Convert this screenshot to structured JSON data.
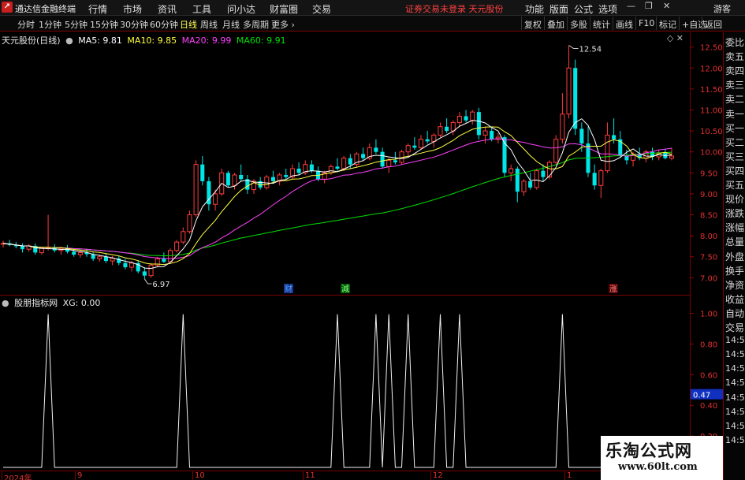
{
  "menubar": {
    "logo_glyph": "↗",
    "app_title": "通达信金融终端",
    "items": [
      "行情",
      "市场",
      "资讯",
      "工具",
      "问小达",
      "财富圈",
      "交易"
    ],
    "notice": "证券交易未登录  天元股份",
    "right_items": [
      "功能",
      "版面",
      "公式",
      "选项"
    ],
    "guest": "游客"
  },
  "tabbar": {
    "periods": [
      "分时",
      "1分钟",
      "5分钟",
      "15分钟",
      "30分钟",
      "60分钟",
      "日线",
      "周线",
      "月线",
      "多周期",
      "更多"
    ],
    "active_period": "日线",
    "tools": [
      "复权",
      "叠加",
      "多股",
      "统计",
      "画线",
      "F10",
      "标记",
      "+自选",
      "返回"
    ]
  },
  "main_legend": {
    "title": "天元股份(日线)",
    "ma5": "MA5: 9.81",
    "ma10": "MA10: 9.85",
    "ma20": "MA20: 9.99",
    "ma60": "MA60: 9.91",
    "colors": {
      "ma5": "#ffffff",
      "ma10": "#ffff40",
      "ma20": "#ff40ff",
      "ma60": "#00e000"
    }
  },
  "indicator_legend": {
    "title": "股朋指标网",
    "xg": "XG: 0.00"
  },
  "right_panel": [
    "委比",
    "卖五",
    "卖四",
    "卖三",
    "卖二",
    "卖一",
    "买一",
    "买二",
    "买三",
    "买四",
    "买五",
    "现价",
    "涨跌",
    "涨幅",
    "总量",
    "外盘",
    "换手",
    "净资",
    "收益",
    "自动",
    "交易",
    "14:56",
    "14:56",
    "14:56",
    "14:56",
    "14:56",
    "14:56",
    "14:56",
    "14:56"
  ],
  "date_axis": [
    "2024年",
    "9",
    "10",
    "11",
    "12",
    "1"
  ],
  "event_markers": [
    "财",
    "減",
    "涨"
  ],
  "watermark": {
    "line1": "乐淘公式网",
    "line2": "www.60lt.com"
  },
  "chart_data": [
    {
      "type": "candlestick",
      "title": "天元股份(日线)",
      "ylim": [
        6.8,
        12.7
      ],
      "yticks": [
        7.0,
        7.5,
        8.0,
        8.5,
        9.0,
        9.5,
        10.0,
        10.5,
        11.0,
        11.5,
        12.0,
        12.5
      ],
      "annotations": {
        "high": "12.54",
        "low": "6.97"
      },
      "ohlc": [
        [
          7.8,
          7.88,
          7.72,
          7.82
        ],
        [
          7.82,
          7.9,
          7.75,
          7.78
        ],
        [
          7.78,
          7.85,
          7.7,
          7.75
        ],
        [
          7.75,
          7.82,
          7.6,
          7.68
        ],
        [
          7.68,
          7.8,
          7.62,
          7.76
        ],
        [
          7.76,
          7.82,
          7.55,
          7.6
        ],
        [
          7.6,
          7.72,
          7.55,
          7.7
        ],
        [
          7.7,
          8.5,
          7.65,
          7.72
        ],
        [
          7.72,
          7.8,
          7.6,
          7.65
        ],
        [
          7.65,
          7.74,
          7.55,
          7.7
        ],
        [
          7.7,
          7.78,
          7.58,
          7.62
        ],
        [
          7.62,
          7.7,
          7.5,
          7.55
        ],
        [
          7.55,
          7.65,
          7.48,
          7.6
        ],
        [
          7.6,
          7.68,
          7.5,
          7.56
        ],
        [
          7.56,
          7.6,
          7.4,
          7.45
        ],
        [
          7.45,
          7.55,
          7.38,
          7.5
        ],
        [
          7.5,
          7.58,
          7.35,
          7.4
        ],
        [
          7.4,
          7.52,
          7.3,
          7.46
        ],
        [
          7.46,
          7.52,
          7.3,
          7.35
        ],
        [
          7.35,
          7.45,
          7.2,
          7.25
        ],
        [
          7.25,
          7.4,
          7.15,
          7.35
        ],
        [
          7.35,
          7.4,
          7.1,
          7.15
        ],
        [
          7.15,
          7.25,
          6.97,
          7.05
        ],
        [
          7.05,
          7.35,
          7.0,
          7.3
        ],
        [
          7.3,
          7.5,
          7.25,
          7.45
        ],
        [
          7.45,
          7.6,
          7.35,
          7.38
        ],
        [
          7.38,
          7.7,
          7.35,
          7.65
        ],
        [
          7.65,
          7.9,
          7.6,
          7.85
        ],
        [
          7.85,
          8.2,
          7.8,
          8.1
        ],
        [
          8.1,
          8.6,
          8.05,
          8.5
        ],
        [
          8.5,
          9.8,
          8.45,
          9.7
        ],
        [
          9.7,
          9.9,
          9.2,
          9.3
        ],
        [
          9.3,
          9.4,
          8.6,
          8.75
        ],
        [
          8.75,
          9.1,
          8.6,
          9.0
        ],
        [
          9.0,
          9.6,
          8.95,
          9.5
        ],
        [
          9.5,
          9.55,
          9.15,
          9.2
        ],
        [
          9.2,
          9.5,
          9.1,
          9.45
        ],
        [
          9.45,
          9.7,
          9.3,
          9.35
        ],
        [
          9.35,
          9.45,
          9.0,
          9.1
        ],
        [
          9.1,
          9.35,
          9.0,
          9.3
        ],
        [
          9.3,
          9.4,
          9.1,
          9.15
        ],
        [
          9.15,
          9.45,
          9.1,
          9.4
        ],
        [
          9.4,
          9.55,
          9.25,
          9.3
        ],
        [
          9.3,
          9.5,
          9.2,
          9.45
        ],
        [
          9.45,
          9.6,
          9.35,
          9.4
        ],
        [
          9.4,
          9.7,
          9.35,
          9.6
        ],
        [
          9.6,
          9.75,
          9.45,
          9.5
        ],
        [
          9.5,
          9.8,
          9.45,
          9.7
        ],
        [
          9.7,
          9.8,
          9.5,
          9.55
        ],
        [
          9.55,
          9.65,
          9.3,
          9.35
        ],
        [
          9.35,
          9.55,
          9.25,
          9.5
        ],
        [
          9.5,
          9.7,
          9.45,
          9.65
        ],
        [
          9.65,
          9.85,
          9.55,
          9.6
        ],
        [
          9.6,
          9.9,
          9.55,
          9.85
        ],
        [
          9.85,
          9.95,
          9.6,
          9.7
        ],
        [
          9.7,
          10.0,
          9.65,
          9.95
        ],
        [
          9.95,
          10.1,
          9.8,
          9.85
        ],
        [
          9.85,
          10.2,
          9.8,
          10.1
        ],
        [
          10.1,
          10.3,
          9.95,
          10.0
        ],
        [
          10.0,
          10.1,
          9.6,
          9.65
        ],
        [
          9.65,
          9.85,
          9.5,
          9.8
        ],
        [
          9.8,
          10.0,
          9.7,
          9.75
        ],
        [
          9.75,
          10.05,
          9.7,
          10.0
        ],
        [
          10.0,
          10.2,
          9.9,
          10.15
        ],
        [
          10.15,
          10.35,
          10.05,
          10.1
        ],
        [
          10.1,
          10.4,
          10.05,
          10.3
        ],
        [
          10.3,
          10.5,
          10.2,
          10.25
        ],
        [
          10.25,
          10.45,
          10.1,
          10.4
        ],
        [
          10.4,
          10.7,
          10.35,
          10.6
        ],
        [
          10.6,
          10.8,
          10.45,
          10.5
        ],
        [
          10.5,
          10.75,
          10.4,
          10.7
        ],
        [
          10.7,
          10.95,
          10.6,
          10.85
        ],
        [
          10.85,
          11.0,
          10.7,
          10.75
        ],
        [
          10.75,
          11.0,
          10.65,
          10.95
        ],
        [
          10.95,
          11.05,
          10.3,
          10.4
        ],
        [
          10.4,
          10.6,
          10.2,
          10.5
        ],
        [
          10.5,
          10.6,
          10.25,
          10.3
        ],
        [
          10.3,
          10.45,
          10.2,
          10.35
        ],
        [
          10.35,
          10.4,
          9.4,
          9.5
        ],
        [
          9.5,
          9.7,
          9.3,
          9.6
        ],
        [
          9.6,
          9.65,
          8.8,
          9.05
        ],
        [
          9.05,
          9.35,
          8.95,
          9.3
        ],
        [
          9.3,
          9.5,
          9.1,
          9.15
        ],
        [
          9.15,
          9.6,
          9.1,
          9.55
        ],
        [
          9.55,
          9.7,
          9.3,
          9.4
        ],
        [
          9.4,
          9.8,
          9.35,
          9.75
        ],
        [
          9.75,
          10.4,
          9.7,
          10.3
        ],
        [
          10.3,
          11.4,
          10.2,
          10.9
        ],
        [
          10.9,
          12.54,
          10.8,
          12.0
        ],
        [
          12.0,
          12.2,
          10.4,
          10.55
        ],
        [
          10.55,
          10.7,
          10.0,
          10.2
        ],
        [
          10.2,
          10.6,
          9.4,
          9.5
        ],
        [
          9.5,
          9.7,
          9.1,
          9.2
        ],
        [
          9.2,
          9.6,
          8.9,
          9.55
        ],
        [
          9.55,
          10.7,
          9.5,
          10.4
        ],
        [
          10.4,
          10.8,
          10.2,
          10.3
        ],
        [
          10.3,
          10.5,
          9.85,
          9.9
        ],
        [
          9.9,
          10.05,
          9.7,
          9.8
        ],
        [
          9.8,
          10.0,
          9.65,
          9.95
        ],
        [
          9.95,
          10.1,
          9.8,
          9.85
        ],
        [
          9.85,
          10.05,
          9.75,
          10.0
        ],
        [
          10.0,
          10.1,
          9.8,
          9.88
        ],
        [
          9.88,
          10.05,
          9.8,
          9.98
        ],
        [
          9.98,
          10.08,
          9.82,
          9.85
        ],
        [
          9.85,
          10.1,
          9.8,
          9.9
        ]
      ]
    },
    {
      "type": "line",
      "title": "股朋指标网",
      "series": [
        {
          "name": "XG",
          "spike_indices": [
            7,
            28,
            52,
            58,
            60,
            63,
            68,
            71,
            87
          ]
        }
      ],
      "ylim": [
        0,
        1.08
      ],
      "yticks": [
        0.0,
        0.2,
        0.4,
        0.6,
        0.8,
        1.0
      ],
      "current_value_label": "0.47"
    }
  ]
}
